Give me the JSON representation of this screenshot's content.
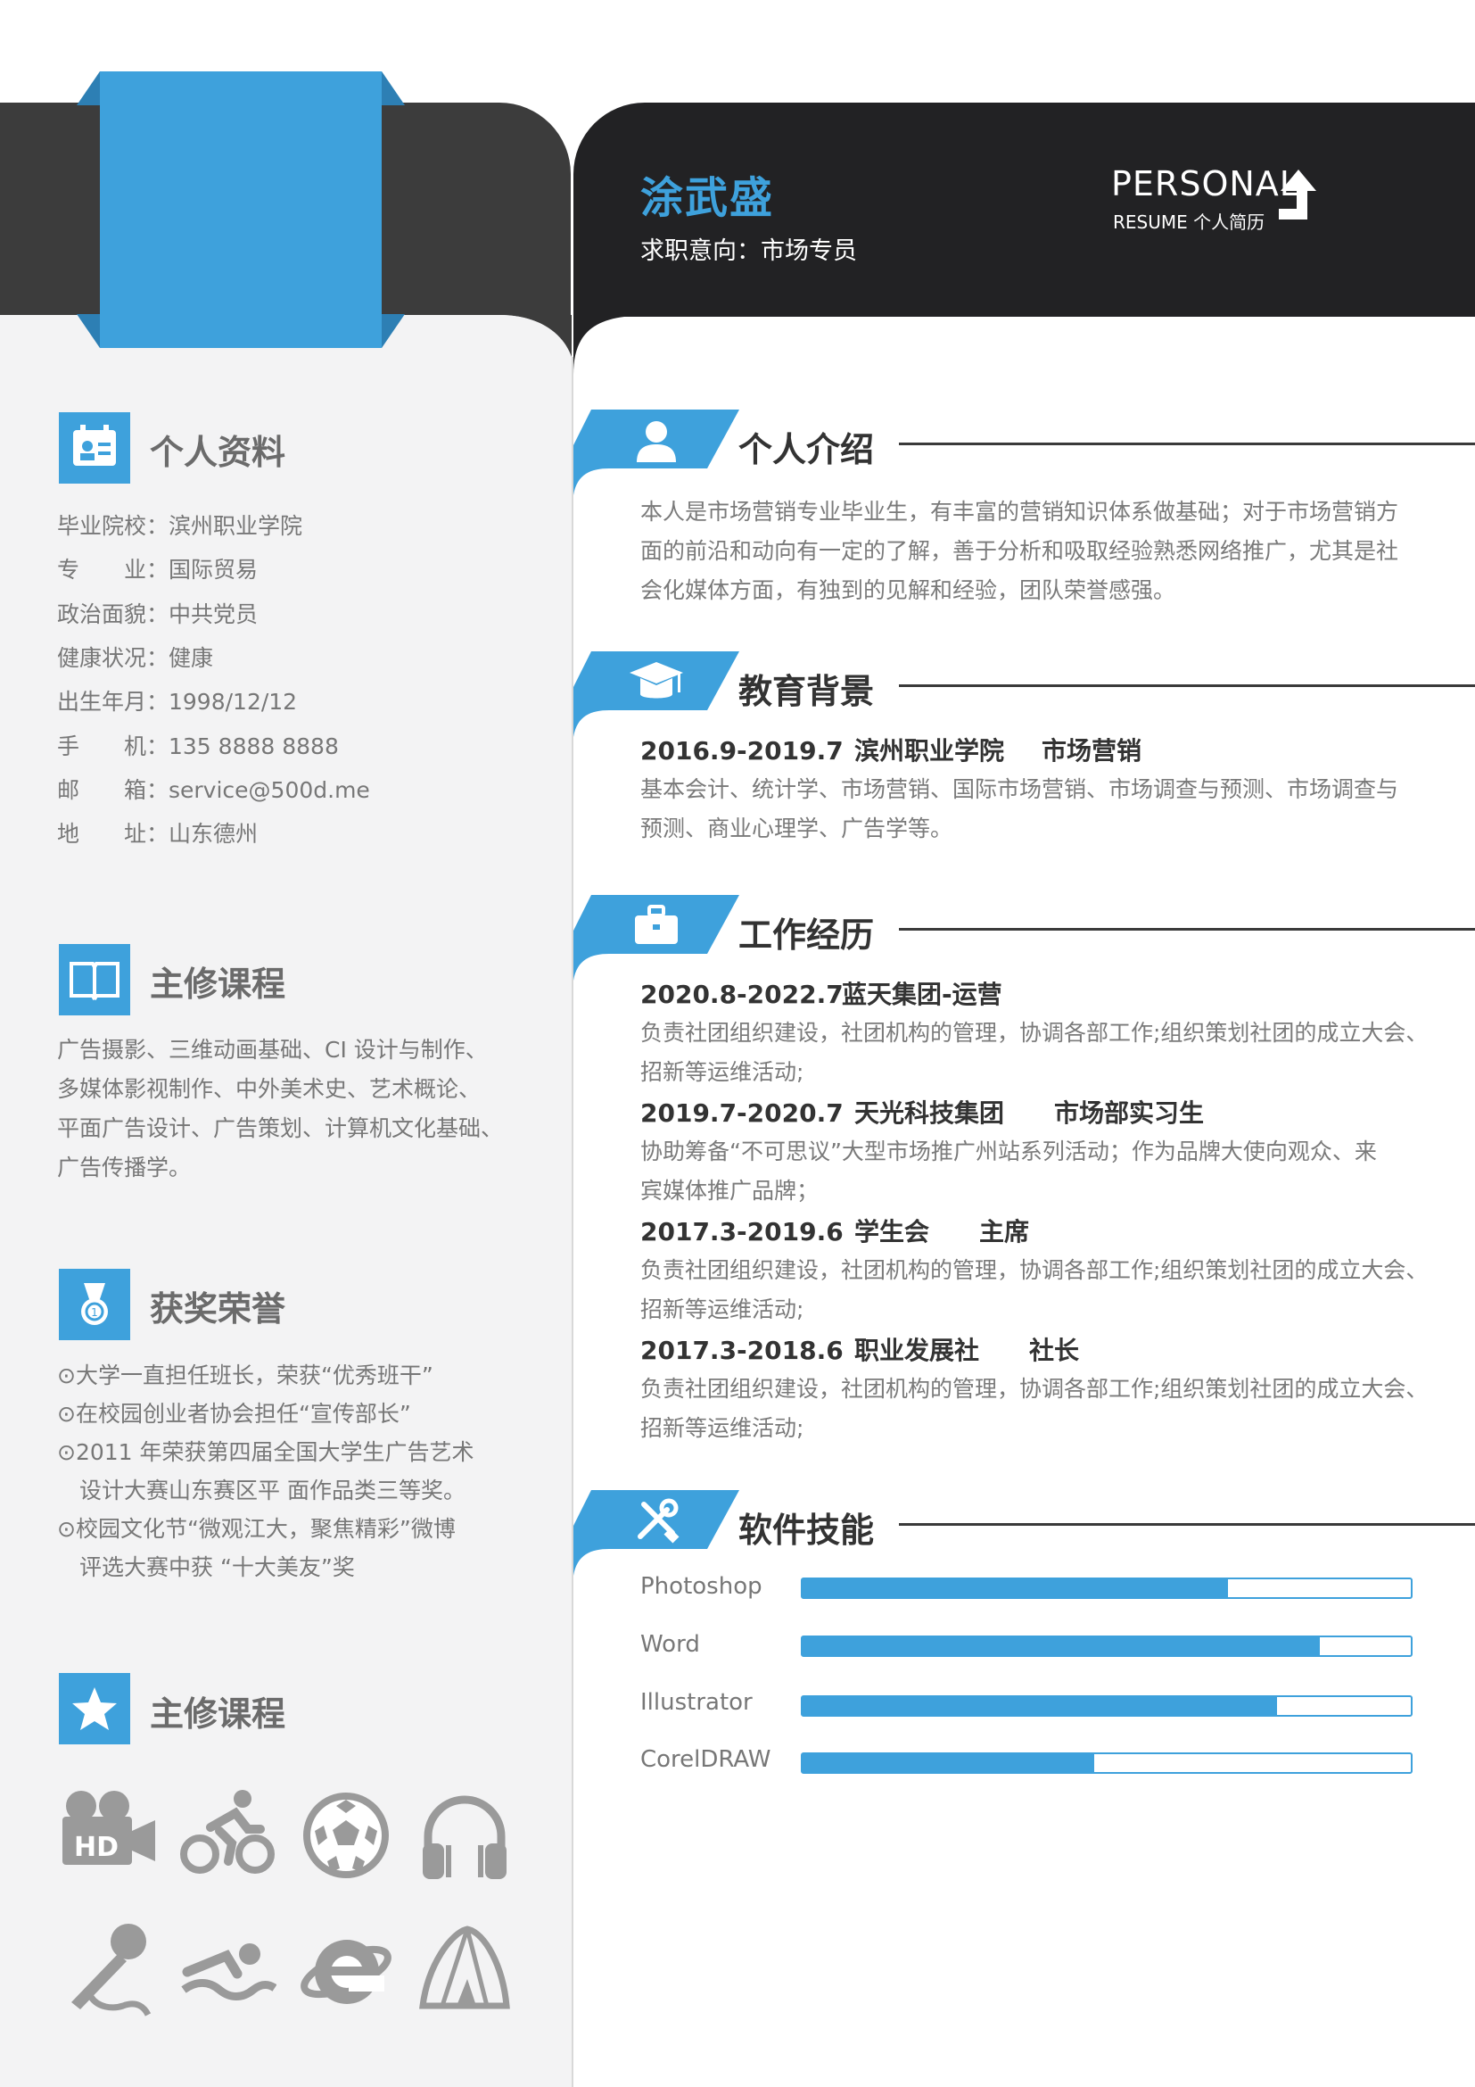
{
  "header": {
    "name": "涂武盛",
    "intent": "求职意向：市场专员",
    "personal": "PERSONAL",
    "resume_sub": "RESUME 个人简历"
  },
  "left": {
    "profile_title": "个人资料",
    "profile": [
      "毕业院校：滨州职业学院",
      "专　　业：国际贸易",
      "政治面貌：中共党员",
      "健康状况：健康",
      "出生年月：1998/12/12",
      "手　　机：135 8888 8888",
      "邮　　箱：service@500d.me",
      "地　　址：山东德州"
    ],
    "courses_title": "主修课程",
    "courses": [
      "广告摄影、三维动画基础、CI 设计与制作、",
      "多媒体影视制作、中外美术史、艺术概论、",
      "平面广告设计、广告策划、计算机文化基础、",
      "广告传播学。"
    ],
    "awards_title": "获奖荣誉",
    "awards": [
      "⊙大学一直担任班长，荣获“优秀班干”",
      "⊙在校园创业者协会担任“宣传部长”",
      "⊙2011 年荣获第四届全国大学生广告艺术",
      "　设计大赛山东赛区平 面作品类三等奖。",
      "⊙校园文化节“微观江大，聚焦精彩”微博",
      "　评选大赛中获 “十大美友”奖"
    ],
    "hobby_title": "主修课程",
    "hobby_icons": [
      "hd-camera-icon",
      "cycling-icon",
      "football-icon",
      "headphones-icon",
      "singing-icon",
      "swimming-icon",
      "internet-explorer-icon",
      "tent-icon"
    ]
  },
  "right": {
    "intro_title": "个人介绍",
    "intro": [
      "本人是市场营销专业毕业生，有丰富的营销知识体系做基础；对于市场营销方",
      "面的前沿和动向有一定的了解，善于分析和吸取经验熟悉网络推广，尤其是社",
      "会化媒体方面，有独到的见解和经验，团队荣誉感强。"
    ],
    "edu_title": "教育背景",
    "edu_head": [
      "2016.9-2019.7",
      "滨州职业学院",
      "市场营销"
    ],
    "edu_text": [
      "基本会计、统计学、市场营销、国际市场营销、市场调查与预测、市场调查与",
      "预测、商业心理学、广告学等。"
    ],
    "work_title": "工作经历",
    "jobs": [
      {
        "period": "2020.8-2022.7",
        "org": "蓝天集团-运营",
        "role": "",
        "lines": [
          "负责社团组织建设，社团机构的管理，协调各部工作;组织策划社团的成立大会、",
          "招新等运维活动;"
        ]
      },
      {
        "period": "2019.7-2020.7",
        "org": "天光科技集团",
        "role": "市场部实习生",
        "lines": [
          "协助筹备“不可思议”大型市场推广州站系列活动；作为品牌大使向观众、来",
          "宾媒体推广品牌；"
        ]
      },
      {
        "period": "2017.3-2019.6",
        "org": "学生会",
        "role": "主席",
        "lines": [
          "负责社团组织建设，社团机构的管理，协调各部工作;组织策划社团的成立大会、",
          "招新等运维活动;"
        ]
      },
      {
        "period": "2017.3-2018.6",
        "org": "职业发展社",
        "role": "社长",
        "lines": [
          "负责社团组织建设，社团机构的管理，协调各部工作;组织策划社团的成立大会、",
          "招新等运维活动;"
        ]
      }
    ],
    "skills_title": "软件技能",
    "skills": [
      {
        "name": "Photoshop",
        "level": 0.7
      },
      {
        "name": "Word",
        "level": 0.85
      },
      {
        "name": "Illustrator",
        "level": 0.78
      },
      {
        "name": "CorelDRAW",
        "level": 0.48
      }
    ],
    "colors": {
      "accent": "#3ea1dc",
      "dark": "#222224",
      "band": "#3c3c3c",
      "sidebar": "#f3f3f4"
    }
  }
}
